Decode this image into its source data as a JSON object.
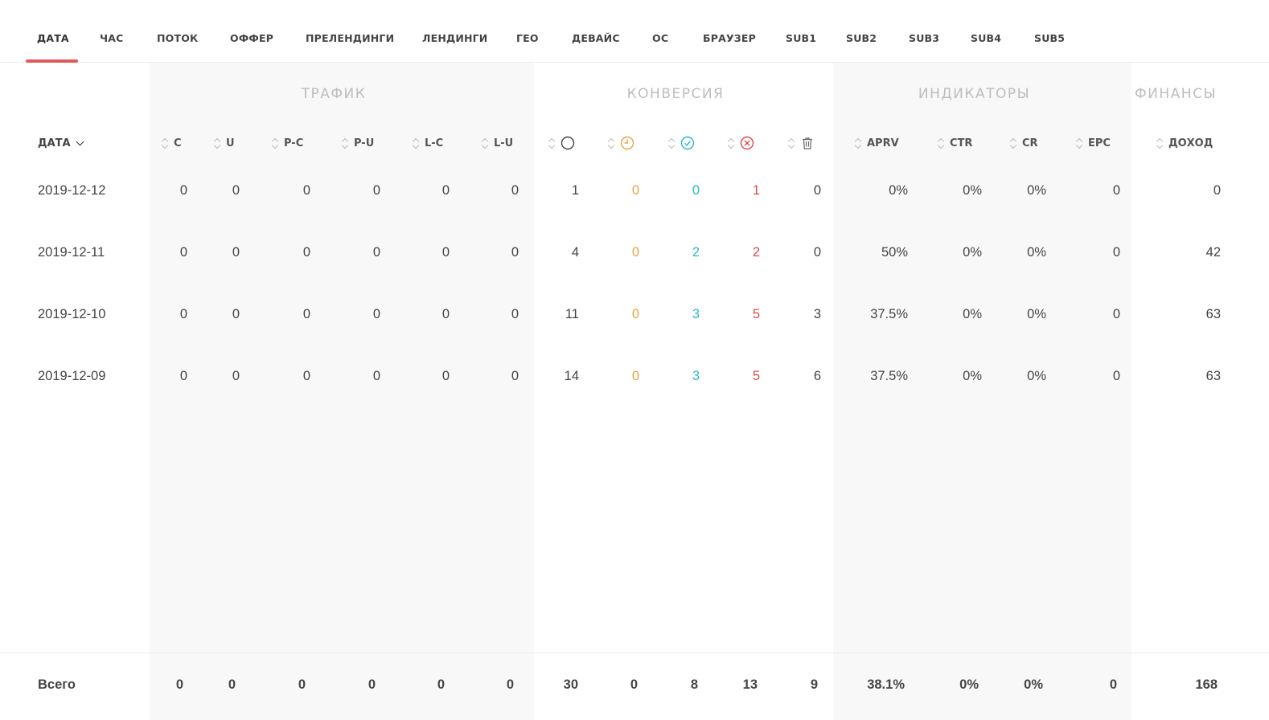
{
  "tabs": [
    "ДАТА",
    "ЧАС",
    "ПОТОК",
    "ОФФЕР",
    "ПРЕЛЕНДИНГИ",
    "ЛЕНДИНГИ",
    "ГЕО",
    "ДЕВАЙС",
    "ОС",
    "БРАУЗЕР",
    "SUB1",
    "SUB2",
    "SUB3",
    "SUB4",
    "SUB5"
  ],
  "active_tab": "ДАТА",
  "groups": {
    "traffic": "ТРАФИК",
    "conversion": "КОНВЕРСИЯ",
    "indicators": "ИНДИКАТОРЫ",
    "finance": "ФИНАНСЫ"
  },
  "columns": {
    "date": "ДАТА",
    "c": "C",
    "u": "U",
    "pc": "P-C",
    "pu": "P-U",
    "lc": "L-C",
    "lu": "L-U",
    "total_icon": "circle-icon",
    "pending_icon": "clock-icon",
    "approved_icon": "check-circle-icon",
    "rejected_icon": "x-circle-icon",
    "trash_icon": "trash-icon",
    "aprv": "APRV",
    "ctr": "CTR",
    "cr": "CR",
    "epc": "EPC",
    "income": "ДОХОД"
  },
  "rows": [
    {
      "date": "2019-12-12",
      "c": "0",
      "u": "0",
      "pc": "0",
      "pu": "0",
      "lc": "0",
      "lu": "0",
      "total": "1",
      "pending": "0",
      "approved": "0",
      "rejected": "1",
      "trash": "0",
      "aprv": "0%",
      "ctr": "0%",
      "cr": "0%",
      "epc": "0",
      "income": "0"
    },
    {
      "date": "2019-12-11",
      "c": "0",
      "u": "0",
      "pc": "0",
      "pu": "0",
      "lc": "0",
      "lu": "0",
      "total": "4",
      "pending": "0",
      "approved": "2",
      "rejected": "2",
      "trash": "0",
      "aprv": "50%",
      "ctr": "0%",
      "cr": "0%",
      "epc": "0",
      "income": "42"
    },
    {
      "date": "2019-12-10",
      "c": "0",
      "u": "0",
      "pc": "0",
      "pu": "0",
      "lc": "0",
      "lu": "0",
      "total": "11",
      "pending": "0",
      "approved": "3",
      "rejected": "5",
      "trash": "3",
      "aprv": "37.5%",
      "ctr": "0%",
      "cr": "0%",
      "epc": "0",
      "income": "63"
    },
    {
      "date": "2019-12-09",
      "c": "0",
      "u": "0",
      "pc": "0",
      "pu": "0",
      "lc": "0",
      "lu": "0",
      "total": "14",
      "pending": "0",
      "approved": "3",
      "rejected": "5",
      "trash": "6",
      "aprv": "37.5%",
      "ctr": "0%",
      "cr": "0%",
      "epc": "0",
      "income": "63"
    }
  ],
  "totals": {
    "label": "Всего",
    "c": "0",
    "u": "0",
    "pc": "0",
    "pu": "0",
    "lc": "0",
    "lu": "0",
    "total": "30",
    "pending": "0",
    "approved": "8",
    "rejected": "13",
    "trash": "9",
    "aprv": "38.1%",
    "ctr": "0%",
    "cr": "0%",
    "epc": "0",
    "income": "168"
  },
  "colors": {
    "accent": "#e05a5a",
    "pending": "#f0a040",
    "approved": "#2bb8c9",
    "rejected": "#e04848"
  }
}
